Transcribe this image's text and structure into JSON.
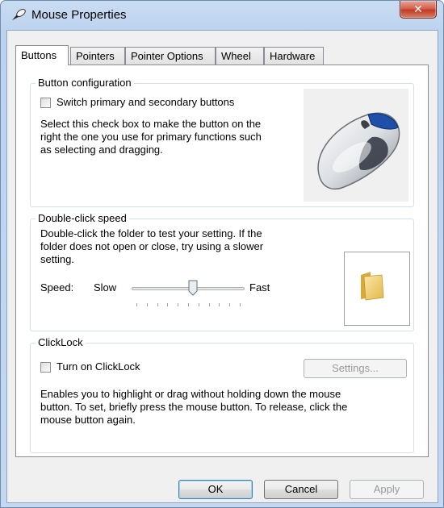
{
  "window": {
    "title": "Mouse Properties",
    "close_glyph": "✕"
  },
  "tabs": [
    {
      "label": "Buttons",
      "active": true
    },
    {
      "label": "Pointers",
      "active": false
    },
    {
      "label": "Pointer Options",
      "active": false
    },
    {
      "label": "Wheel",
      "active": false
    },
    {
      "label": "Hardware",
      "active": false
    }
  ],
  "button_config": {
    "legend": "Button configuration",
    "checkbox_label": "Switch primary and secondary buttons",
    "checked": false,
    "description_lines": [
      "Select this check box to make the button on the",
      "right the one you use for primary functions such",
      "as selecting and dragging."
    ]
  },
  "double_click": {
    "legend": "Double-click speed",
    "description_lines": [
      "Double-click the folder to test your setting. If the",
      "folder does not open or close, try using a slower",
      "setting."
    ],
    "speed_label": "Speed:",
    "slow_label": "Slow",
    "fast_label": "Fast",
    "slider_value": 0.55
  },
  "clicklock": {
    "legend": "ClickLock",
    "checkbox_label": "Turn on ClickLock",
    "checked": false,
    "settings_label": "Settings...",
    "description_lines": [
      "Enables you to highlight or drag without holding down the mouse",
      "button. To set, briefly press the mouse button. To release, click the",
      "mouse button again."
    ]
  },
  "footer": {
    "ok_label": "OK",
    "cancel_label": "Cancel",
    "apply_label": "Apply"
  },
  "icons": {
    "title": "mouse-pointer-icon",
    "mouse_illustration": "mouse-illustration",
    "folder": "folder-icon"
  }
}
